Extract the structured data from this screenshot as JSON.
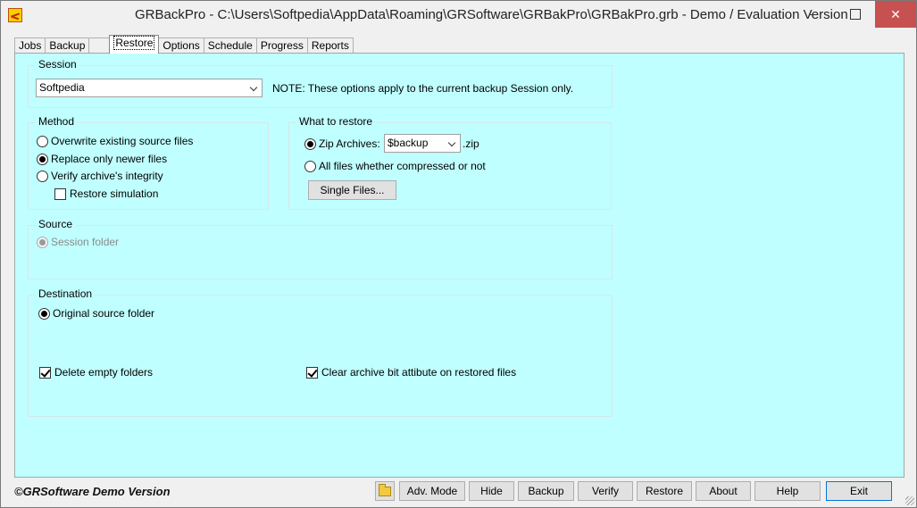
{
  "window": {
    "title": "GRBackPro - C:\\Users\\Softpedia\\AppData\\Roaming\\GRSoftware\\GRBakPro\\GRBakPro.grb - Demo / Evaluation Version",
    "minimize_glyph": "",
    "maximize_glyph": "",
    "close_glyph": "✕"
  },
  "tabs": [
    "Jobs",
    "Backup",
    "",
    "Restore",
    "Options",
    "Schedule",
    "Progress",
    "Reports"
  ],
  "session": {
    "title": "Session",
    "selected": "Softpedia",
    "note": "NOTE: These options apply to the current backup Session only."
  },
  "method": {
    "title": "Method",
    "options": [
      "Overwrite existing source files",
      "Replace only newer files",
      "Verify archive's integrity"
    ],
    "simulation": "Restore simulation"
  },
  "what_to_restore": {
    "title": "What to restore",
    "zip_label": "Zip Archives:",
    "zip_selected": "$backup",
    "zip_ext": ".zip",
    "all_files": "All files whether compressed or not",
    "single_files_button": "Single Files..."
  },
  "source": {
    "title": "Source",
    "option": "Session folder"
  },
  "destination": {
    "title": "Destination",
    "option": "Original source folder",
    "delete_empty": "Delete empty folders",
    "clear_archive_bit": "Clear archive bit attibute on restored files"
  },
  "statusbar": {
    "copyright": "©GRSoftware Demo Version",
    "buttons": [
      "Adv. Mode",
      "Hide",
      "Backup",
      "Verify",
      "Restore",
      "About",
      "Help",
      "Exit"
    ]
  }
}
